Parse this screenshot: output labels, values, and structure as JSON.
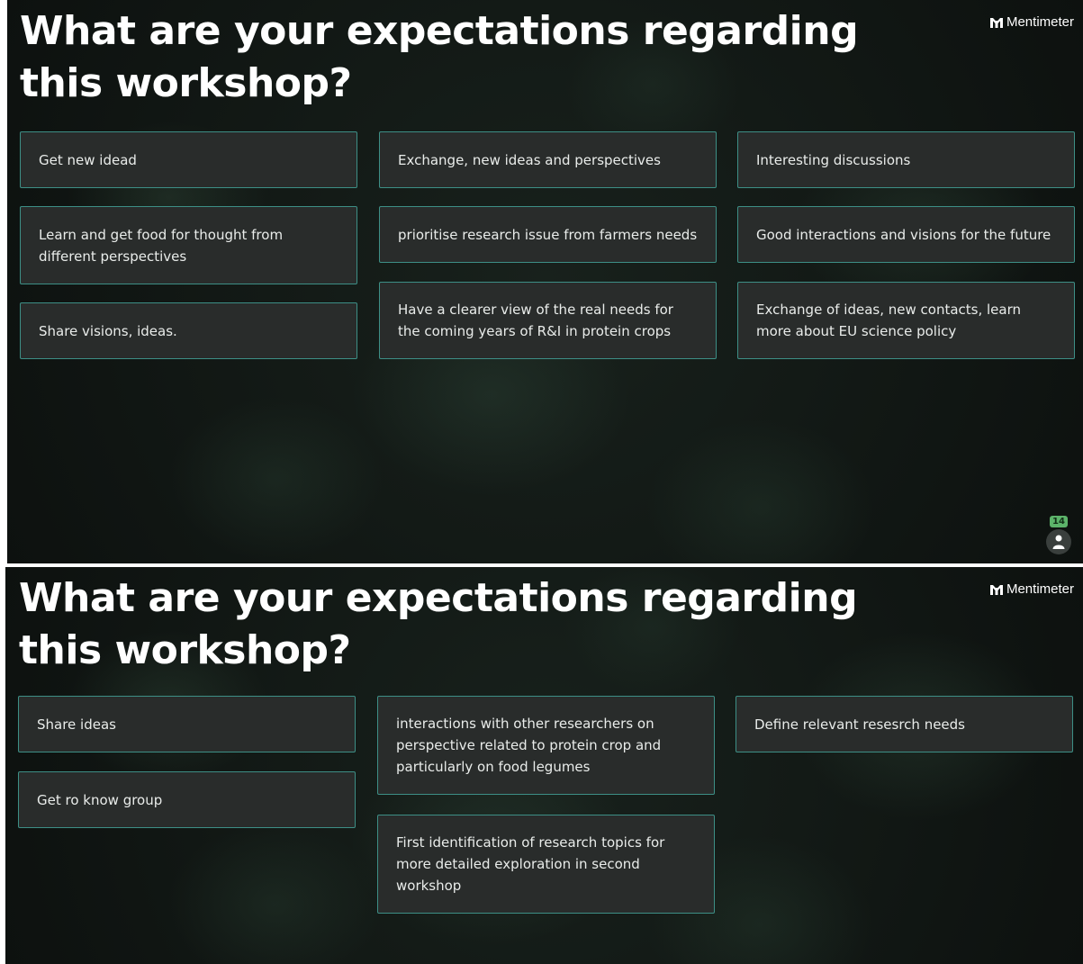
{
  "slides": [
    {
      "title": "What are your expectations regarding this workshop?",
      "brand": "Mentimeter",
      "participant_count": "14",
      "responses": [
        "Get new idead",
        "Exchange, new ideas and perspectives",
        "Interesting discussions",
        "Learn and get food for thought from different perspectives",
        "prioritise research issue from farmers needs",
        "Good interactions and visions for the future",
        "Share visions, ideas.",
        "Have a clearer view of the real needs for the coming years of R&I in protein crops",
        "Exchange of ideas, new contacts, learn more about EU science policy"
      ]
    },
    {
      "title": "What are your expectations regarding this workshop?",
      "brand": "Mentimeter",
      "responses": [
        "Share ideas",
        "interactions with other researchers on perspective related to protein crop and particularly on food legumes",
        "Define relevant resesrch needs",
        "Get ro know group",
        "First identification of research topics for more detailed exploration in second workshop"
      ]
    }
  ],
  "icons": {
    "brand_logo": "mentimeter-logo-icon",
    "participants": "person-icon"
  },
  "colors": {
    "card_background": "#292c2b",
    "card_border": "#3d8f86",
    "badge_green": "#5cb36a"
  }
}
